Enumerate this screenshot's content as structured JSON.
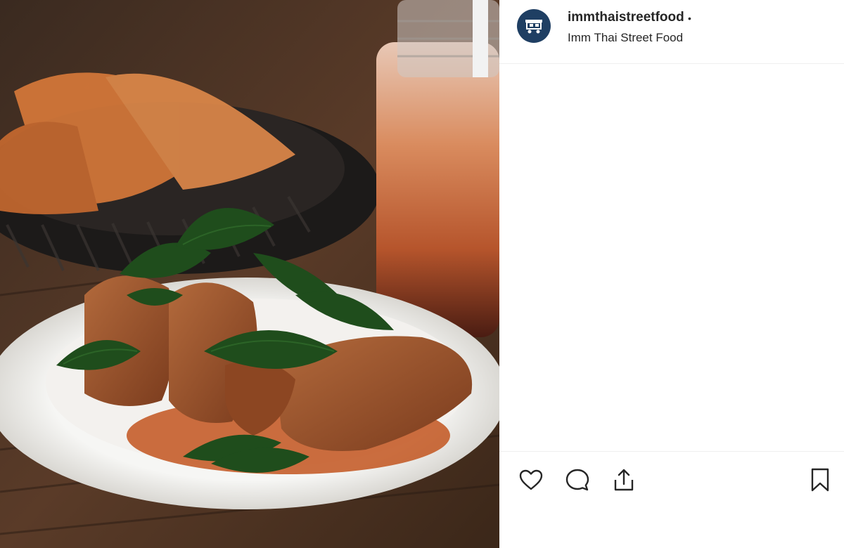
{
  "post": {
    "image_alt": "Crispy chicken wings with fried basil on a white plate, basket of fried food and Thai iced tea jar behind"
  },
  "header": {
    "username": "immthaistreetfood",
    "separator": "•",
    "location": "Imm Thai Street Food",
    "avatar_icon": "food-cart-icon"
  },
  "actions": {
    "like_icon": "heart-icon",
    "comment_icon": "comment-icon",
    "share_icon": "share-icon",
    "save_icon": "bookmark-icon"
  },
  "colors": {
    "avatar_bg": "#1f3f63",
    "text": "#262626",
    "divider": "#efefef"
  }
}
